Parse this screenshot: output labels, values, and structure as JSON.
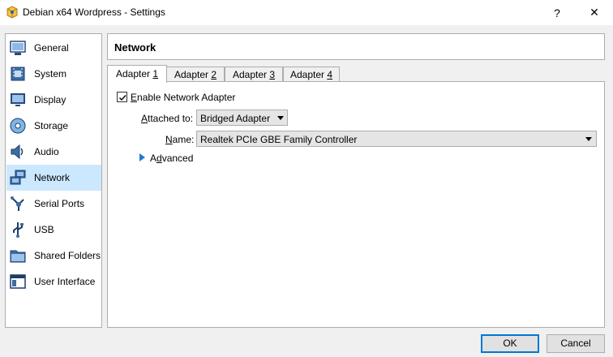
{
  "window": {
    "title": "Debian x64 Wordpress - Settings",
    "help_label": "?",
    "close_label": "✕"
  },
  "sidebar": {
    "items": [
      {
        "label": "General",
        "icon": "general-icon"
      },
      {
        "label": "System",
        "icon": "system-icon"
      },
      {
        "label": "Display",
        "icon": "display-icon"
      },
      {
        "label": "Storage",
        "icon": "storage-icon"
      },
      {
        "label": "Audio",
        "icon": "audio-icon"
      },
      {
        "label": "Network",
        "icon": "network-icon",
        "selected": true
      },
      {
        "label": "Serial Ports",
        "icon": "serial-ports-icon"
      },
      {
        "label": "USB",
        "icon": "usb-icon"
      },
      {
        "label": "Shared Folders",
        "icon": "shared-folders-icon"
      },
      {
        "label": "User Interface",
        "icon": "user-interface-icon"
      }
    ]
  },
  "page": {
    "title": "Network"
  },
  "tabs": [
    {
      "prefix": "Adapter ",
      "accel": "1",
      "active": true
    },
    {
      "prefix": "Adapter ",
      "accel": "2"
    },
    {
      "prefix": "Adapter ",
      "accel": "3"
    },
    {
      "prefix": "Adapter ",
      "accel": "4"
    }
  ],
  "adapter": {
    "enable_prefix": "",
    "enable_accel": "E",
    "enable_rest": "nable Network Adapter",
    "enabled": true,
    "attached_accel": "A",
    "attached_rest": "ttached to:",
    "attached_value": "Bridged Adapter",
    "name_accel": "N",
    "name_rest": "ame:",
    "name_value": "Realtek PCIe GBE Family Controller",
    "advanced_accel": "d",
    "advanced_prefix": "A",
    "advanced_rest": "vanced"
  },
  "buttons": {
    "ok": "OK",
    "cancel": "Cancel"
  },
  "colors": {
    "accent": "#0078d7",
    "selection": "#cce8ff"
  }
}
